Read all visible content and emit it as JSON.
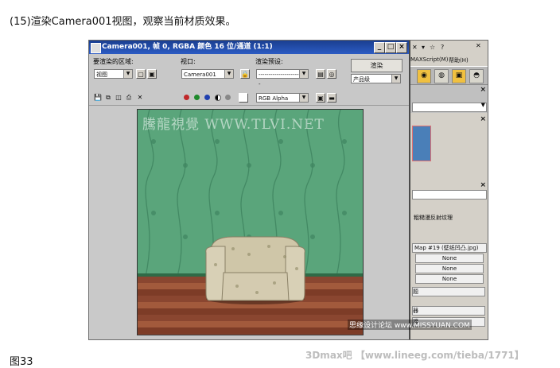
{
  "caption_top": "(15)渲染Camera001视图，观察当前材质效果。",
  "caption_bottom": "图33",
  "render_window": {
    "title": "Camera001, 帧 0, RGBA 颜色 16 位/通道 (1:1)",
    "min_btn": "_",
    "max_btn": "□",
    "close_btn": "×",
    "area_label": "要渲染的区域:",
    "area_value": "视图",
    "viewport_label": "视口:",
    "viewport_value": "Camera001",
    "preset_label": "渲染预设:",
    "preset_value": "-------------------------",
    "render_button": "渲染",
    "product_value": "产品级",
    "channel_value": "RGB Alpha",
    "scene_watermark": "騰龍視覺 WWW.TLVI.NET"
  },
  "right_panel": {
    "menu_script": "MAXScript(M)",
    "menu_help": "帮助(H)",
    "diffuse_label": "粗糙漫反射纹理",
    "map_label": "Map #19 (壁纸凹凸.jpg)",
    "none_labels": [
      "None",
      "None",
      "None"
    ],
    "short_labels": [
      "题",
      "器",
      "接"
    ]
  },
  "site_mark": "思缘设计论坛 www.MISSYUAN.COM",
  "credit": "3Dmax吧 【www.lineeg.com/tieba/1771】",
  "colors": {
    "title_bar": "#2b5bc4",
    "wall": "#5aa57b",
    "floor": "#8a4630",
    "chair": "#d8d0b6"
  }
}
